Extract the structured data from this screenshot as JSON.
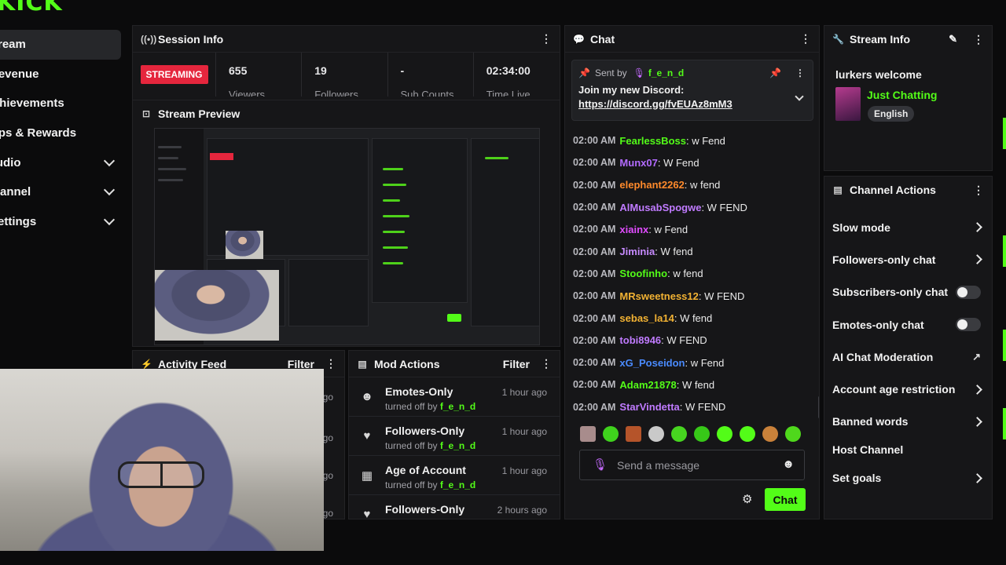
{
  "brand": "KICK",
  "nav": {
    "items": [
      {
        "label": "Stream",
        "active": true,
        "expandable": false
      },
      {
        "label": "Revenue",
        "active": false,
        "expandable": false
      },
      {
        "label": "Achievements",
        "active": false,
        "expandable": false
      },
      {
        "label": "Drops & Rewards",
        "active": false,
        "expandable": false
      },
      {
        "label": "Audio",
        "active": false,
        "expandable": true
      },
      {
        "label": "Channel",
        "active": false,
        "expandable": true
      },
      {
        "label": "Settings",
        "active": false,
        "expandable": true
      }
    ]
  },
  "session": {
    "title": "Session Info",
    "status": "STREAMING",
    "stats": [
      {
        "value": "655",
        "label": "Viewers"
      },
      {
        "value": "19",
        "label": "Followers"
      },
      {
        "value": "-",
        "label": "Sub Counts"
      },
      {
        "value": "02:34:00",
        "label": "Time Live"
      }
    ]
  },
  "preview": {
    "title": "Stream Preview"
  },
  "activity": {
    "title": "Activity Feed",
    "filter": "Filter",
    "times": [
      "ago",
      "ago",
      "ago",
      "ago"
    ]
  },
  "mod": {
    "title": "Mod Actions",
    "filter": "Filter",
    "items": [
      {
        "icon": "smiley-icon",
        "title": "Emotes-Only",
        "sub": "turned off by",
        "user": "f_e_n_d",
        "time": "1 hour ago"
      },
      {
        "icon": "heart-icon",
        "title": "Followers-Only",
        "sub": "turned off by",
        "user": "f_e_n_d",
        "time": "1 hour ago"
      },
      {
        "icon": "calendar-icon",
        "title": "Age of Account",
        "sub": "turned off by",
        "user": "f_e_n_d",
        "time": "1 hour ago"
      },
      {
        "icon": "heart-icon",
        "title": "Followers-Only",
        "sub": "",
        "user": "",
        "time": "2 hours ago"
      }
    ]
  },
  "chat": {
    "title": "Chat",
    "pinned": {
      "sent_by": "Sent by",
      "user": "f_e_n_d",
      "text": "Join my new Discord:",
      "link": "https://discord.gg/fvEUAz8mM3"
    },
    "messages": [
      {
        "time": "02:00 AM",
        "user": "FearlessBoss",
        "color": "#53fc18",
        "msg": "w Fend"
      },
      {
        "time": "02:00 AM",
        "user": "Munx07",
        "color": "#b36bff",
        "msg": "W Fend"
      },
      {
        "time": "02:00 AM",
        "user": "elephant2262",
        "color": "#ff8a2b",
        "msg": "w fend"
      },
      {
        "time": "02:00 AM",
        "user": "AlMusabSpogwe",
        "color": "#c07bff",
        "msg": "W FEND"
      },
      {
        "time": "02:00 AM",
        "user": "xiainx",
        "color": "#e14cff",
        "msg": "w Fend"
      },
      {
        "time": "02:00 AM",
        "user": "Jiminia",
        "color": "#c78bff",
        "msg": "W fend"
      },
      {
        "time": "02:00 AM",
        "user": "Stoofinho",
        "color": "#53fc18",
        "msg": "w fend"
      },
      {
        "time": "02:00 AM",
        "user": "MRsweetness12",
        "color": "#f2b233",
        "msg": "W FEND"
      },
      {
        "time": "02:00 AM",
        "user": "sebas_la14",
        "color": "#f2b233",
        "msg": "W fend"
      },
      {
        "time": "02:00 AM",
        "user": "tobi8946",
        "color": "#c07bff",
        "msg": "W FEND"
      },
      {
        "time": "02:00 AM",
        "user": "xG_Poseidon",
        "color": "#4a8bff",
        "msg": "w Fend"
      },
      {
        "time": "02:00 AM",
        "user": "Adam21878",
        "color": "#53fc18",
        "msg": "W fend"
      },
      {
        "time": "02:00 AM",
        "user": "StarVindetta",
        "color": "#c07bff",
        "msg": "W FEND"
      }
    ],
    "input_placeholder": "Send a message",
    "send_label": "Chat"
  },
  "stream_info": {
    "title": "Stream Info",
    "stream_title": "lurkers welcome",
    "category": "Just Chatting",
    "language": "English"
  },
  "channel_actions": {
    "title": "Channel Actions",
    "items": [
      {
        "label": "Slow mode",
        "control": "arrow"
      },
      {
        "label": "Followers-only chat",
        "control": "arrow"
      },
      {
        "label": "Subscribers-only chat",
        "control": "toggle"
      },
      {
        "label": "Emotes-only chat",
        "control": "toggle"
      },
      {
        "label": "AI Chat Moderation",
        "control": "external"
      },
      {
        "label": "Account age restriction",
        "control": "arrow"
      },
      {
        "label": "Banned words",
        "control": "arrow"
      },
      {
        "label": "Host Channel",
        "control": "none"
      },
      {
        "label": "Set goals",
        "control": "arrow"
      }
    ]
  },
  "colors": {
    "accent": "#53fc18",
    "live": "#e5263d",
    "panel": "#161618"
  }
}
